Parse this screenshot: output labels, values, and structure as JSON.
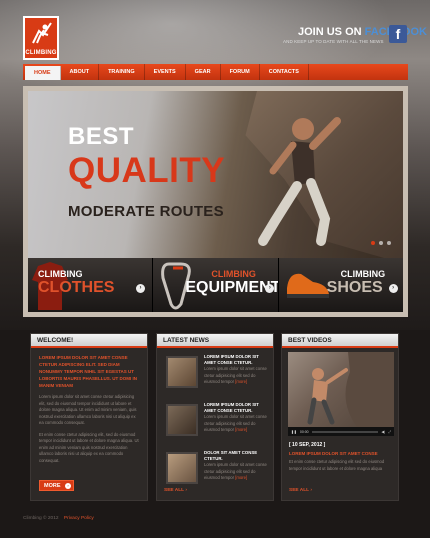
{
  "header": {
    "logo_text": "CLIMBING",
    "facebook": {
      "prefix": "JOIN US ON",
      "brand": "FACEBOOK",
      "tagline": "AND KEEP UP TO DATE WITH ALL THE NEWS",
      "icon": "f"
    }
  },
  "nav": [
    "HOME",
    "ABOUT",
    "TRAINING",
    "EVENTS",
    "GEAR",
    "FORUM",
    "CONTACTS"
  ],
  "slider": {
    "line1": "BEST",
    "line2": "QUALITY",
    "line3": "MODERATE ROUTES",
    "categories": [
      {
        "small": "CLIMBING",
        "big": "CLOTHES",
        "arrow": "›"
      },
      {
        "small": "CLIMBING",
        "big": "EQUIPMENT",
        "arrow": "›"
      },
      {
        "small": "CLIMBING",
        "big": "SHOES",
        "arrow": "›"
      }
    ]
  },
  "welcome": {
    "title": "WELCOME!",
    "lead": "LOREM IPSUM DOLOR SIT AMET CONSE CTETUR ADIPISCING ELIT. SED DIAM NONUMMY TEMPOR NIHIL SIT EGESTAS UT LOBORTIS MAURIS PHASELLUS. UT DOMI IN MANIM VENIAM",
    "p1": "Lorem ipsum dolor sit amet conse ctetur adipisicing elit, sed do eiusmod tempor incididunt ut labore et dolore magna aliqua. Ut enim ad minim veniam, quis nostrud exercitation ullamco laboris nisi ut aliquip ex ea commodo consequat.",
    "p2": "Et enim conse ctetur adipiscing elit, sed do eiusmod tempor incididunt ut labore et dolore magna aliqua. Ut enim ad minim veniam quis nostrud exercitation ullamco laboris nisi ut aliquip ex ea commodo consequat.",
    "more": "MORE"
  },
  "news": {
    "title": "LATEST NEWS",
    "items": [
      {
        "title": "LOREM IPSUM DOLOR SIT AMET CONSE CTETUR.",
        "text": "Lorem ipsum dolor sit amet conse ctetur adipisicing elit sed do eiusmod tempor",
        "more": "[more]"
      },
      {
        "title": "LOREM IPSUM DOLOR SIT AMET CONSE CTETUR.",
        "text": "Lorem ipsum dolor sit amet conse ctetur adipisicing elit sed do eiusmod tempor",
        "more": "[more]"
      },
      {
        "title": "DOLOR SIT AMET CONSE CTETUR.",
        "text": "Lorem ipsum dolor sit amet conse ctetur adipisicing elit sed do eiusmod tempor",
        "more": "[more]"
      }
    ],
    "see_all": "SEE ALL"
  },
  "videos": {
    "title": "BEST VIDEOS",
    "time": "00:00",
    "date": "[ 10 SEP, 2012 ]",
    "caption": "LOREM IPSUM DOLOR SIT AMET CONSE",
    "desc": "Et enim conse ctetur adipiscing elit sed do eiusmod tempor incididunt ut labore et dolore magna aliqua",
    "see_all": "SEE ALL"
  },
  "footer": {
    "copyright": "Climbing © 2012",
    "privacy": "Privacy Policy"
  },
  "colors": {
    "accent": "#d83b15",
    "bg": "#1c1817"
  }
}
